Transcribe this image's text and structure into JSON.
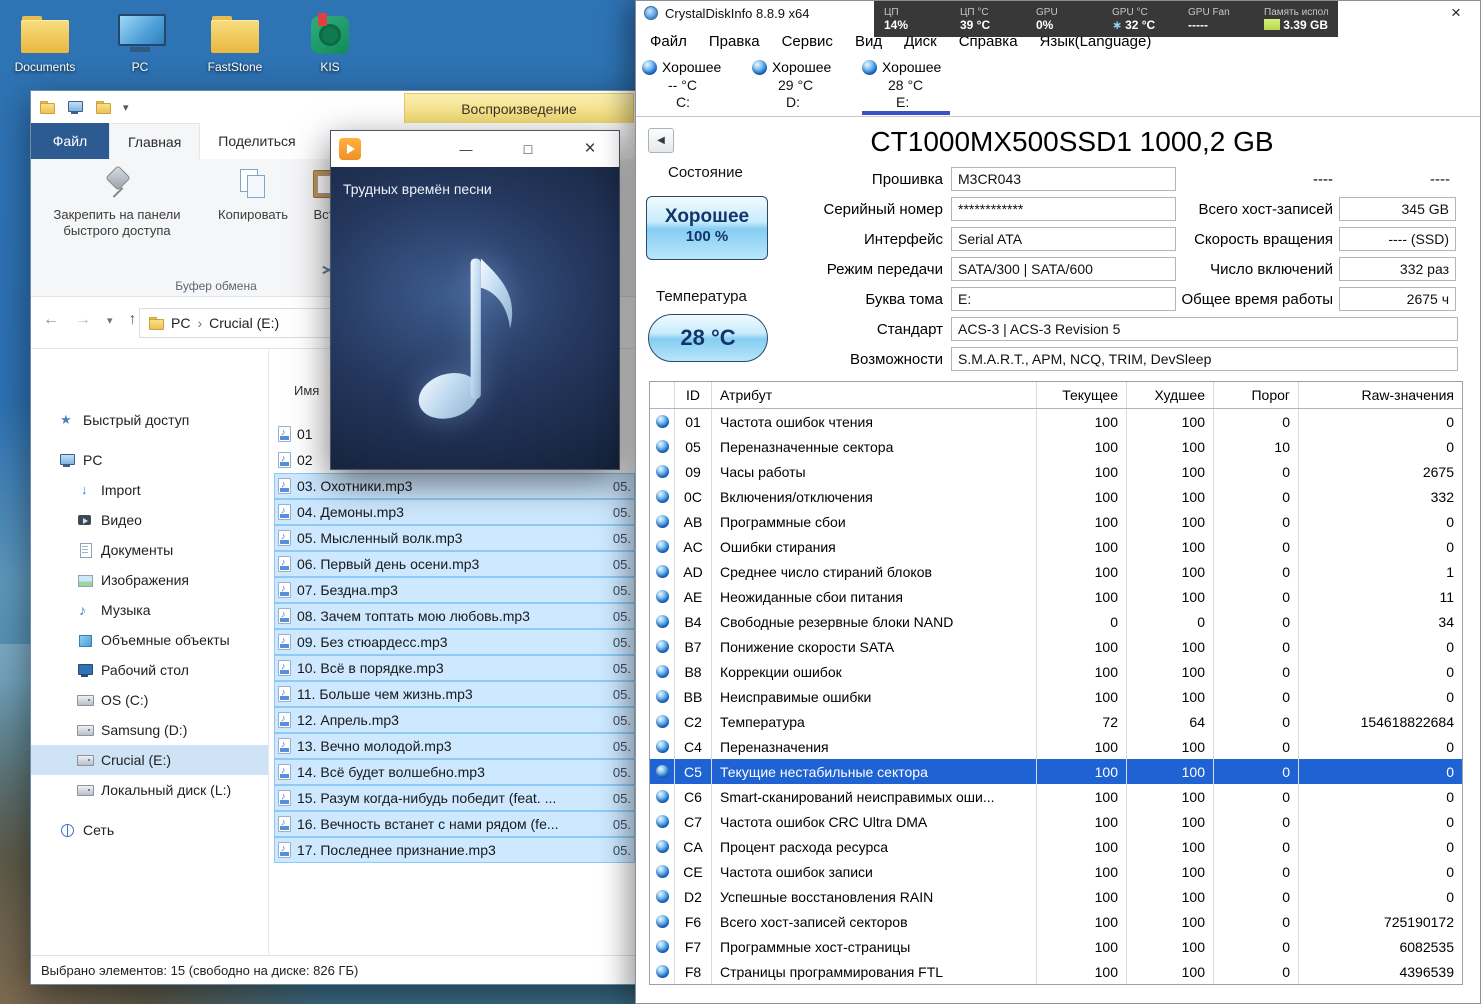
{
  "desktop": {
    "icons": [
      {
        "label": "Documents",
        "icon": "desk-folder"
      },
      {
        "label": "PC",
        "icon": "desk-computer"
      },
      {
        "label": "FastStone",
        "icon": "desk-folder"
      },
      {
        "label": "KIS",
        "icon": "desk-kis"
      }
    ]
  },
  "explorer": {
    "context_tab": "Воспроизведение",
    "file_tab": "Файл",
    "tabs": [
      {
        "label": "Главная",
        "selected": true
      },
      {
        "label": "Поделиться",
        "selected": false
      }
    ],
    "ribbon": {
      "pin": "Закрепить на панели быстрого доступа",
      "copy": "Копировать",
      "paste": "Вст",
      "group": "Буфер обмена"
    },
    "address": {
      "crumb_root": "PC",
      "crumb_current": "Crucial (E:)"
    },
    "sidebar": [
      {
        "label": "Быстрый доступ",
        "icon": "star"
      },
      {
        "label": "PC",
        "icon": "computer",
        "gap": true
      },
      {
        "label": "Import",
        "icon": "download",
        "child": true
      },
      {
        "label": "Видео",
        "icon": "video",
        "child": true
      },
      {
        "label": "Документы",
        "icon": "document",
        "child": true
      },
      {
        "label": "Изображения",
        "icon": "picture",
        "child": true
      },
      {
        "label": "Музыка",
        "icon": "music",
        "child": true
      },
      {
        "label": "Объемные объекты",
        "icon": "box3d",
        "child": true
      },
      {
        "label": "Рабочий стол",
        "icon": "desktop",
        "child": true
      },
      {
        "label": "OS (C:)",
        "icon": "drive",
        "child": true
      },
      {
        "label": "Samsung (D:)",
        "icon": "drive",
        "child": true
      },
      {
        "label": "Crucial (E:)",
        "icon": "drive",
        "child": true,
        "selected": true
      },
      {
        "label": "Локальный диск (L:)",
        "icon": "drive",
        "child": true
      },
      {
        "label": "Сеть",
        "icon": "network",
        "gap": true
      }
    ],
    "list_header": "Имя",
    "files": [
      {
        "name": "01",
        "selected": false,
        "right": ""
      },
      {
        "name": "02",
        "selected": false,
        "right": ""
      },
      {
        "name": "03. Охотники.mp3",
        "selected": true,
        "right": "05."
      },
      {
        "name": "04. Демоны.mp3",
        "selected": true,
        "right": "05."
      },
      {
        "name": "05. Мысленный волк.mp3",
        "selected": true,
        "right": "05."
      },
      {
        "name": "06. Первый день осени.mp3",
        "selected": true,
        "right": "05."
      },
      {
        "name": "07. Бездна.mp3",
        "selected": true,
        "right": "05."
      },
      {
        "name": "08. Зачем топтать мою любовь.mp3",
        "selected": true,
        "right": "05."
      },
      {
        "name": "09. Без стюардесс.mp3",
        "selected": true,
        "right": "05."
      },
      {
        "name": "10. Всё в порядке.mp3",
        "selected": true,
        "right": "05."
      },
      {
        "name": "11. Больше чем жизнь.mp3",
        "selected": true,
        "right": "05."
      },
      {
        "name": "12. Апрель.mp3",
        "selected": true,
        "right": "05."
      },
      {
        "name": "13. Вечно молодой.mp3",
        "selected": true,
        "right": "05."
      },
      {
        "name": "14. Всё будет волшебно.mp3",
        "selected": true,
        "right": "05."
      },
      {
        "name": "15. Разум когда-нибудь победит (feat. ...",
        "selected": true,
        "right": "05."
      },
      {
        "name": "16. Вечность встанет с нами рядом (fe...",
        "selected": true,
        "right": "05."
      },
      {
        "name": "17. Последнее признание.mp3",
        "selected": true,
        "right": "05."
      }
    ],
    "status": "Выбрано элементов: 15 (свободно на диске: 826 ГБ)"
  },
  "player": {
    "song_title": "Трудных времён песни"
  },
  "cdi": {
    "window_title": "CrystalDiskInfo 8.8.9 x64",
    "monitor": [
      {
        "label": "ЦП",
        "value": "14%"
      },
      {
        "label": "ЦП °C",
        "value": "39 °C"
      },
      {
        "label": "GPU",
        "value": "0%"
      },
      {
        "label": "GPU °C",
        "value": "32 °C",
        "cold": true
      },
      {
        "label": "GPU Fan",
        "value": "-----"
      },
      {
        "label": "Память использ...",
        "value": "3.39 GB",
        "bar": true
      }
    ],
    "menu": [
      "Файл",
      "Правка",
      "Сервис",
      "Вид",
      "Диск",
      "Справка",
      "Язык(Language)"
    ],
    "drives": [
      {
        "status": "Хорошее",
        "temp": "-- °C",
        "letter": "C:"
      },
      {
        "status": "Хорошее",
        "temp": "29 °C",
        "letter": "D:"
      },
      {
        "status": "Хорошее",
        "temp": "28 °C",
        "letter": "E:",
        "selected": true
      }
    ],
    "model": "CT1000MX500SSD1 1000,2 GB",
    "health": {
      "label": "Состояние",
      "status": "Хорошее",
      "percent": "100 %"
    },
    "temperature": {
      "label": "Температура",
      "value": "28 °C"
    },
    "info_left": [
      {
        "label": "Прошивка",
        "value": "M3CR043"
      },
      {
        "label": "Серийный номер",
        "value": "************"
      },
      {
        "label": "Интерфейс",
        "value": "Serial ATA"
      },
      {
        "label": "Режим передачи",
        "value": "SATA/300 | SATA/600"
      },
      {
        "label": "Буква тома",
        "value": "E:"
      },
      {
        "label": "Стандарт",
        "value": "ACS-3 | ACS-3 Revision 5",
        "wide": true
      },
      {
        "label": "Возможности",
        "value": "S.M.A.R.T., APM, NCQ, TRIM, DevSleep",
        "wide": true
      }
    ],
    "info_right": [
      {
        "label": "----",
        "value": "----",
        "nobox": true
      },
      {
        "label": "Всего хост-записей",
        "value": "345 GB"
      },
      {
        "label": "Скорость вращения",
        "value": "---- (SSD)"
      },
      {
        "label": "Число включений",
        "value": "332 раз"
      },
      {
        "label": "Общее время работы",
        "value": "2675 ч"
      }
    ],
    "smart_headers": {
      "id": "ID",
      "attr": "Атрибут",
      "cur": "Текущее",
      "worst": "Худшее",
      "thr": "Порог",
      "raw": "Raw-значения"
    },
    "smart_rows": [
      {
        "id": "01",
        "attr": "Частота ошибок чтения",
        "cur": "100",
        "worst": "100",
        "thr": "0",
        "raw": "0"
      },
      {
        "id": "05",
        "attr": "Переназначенные сектора",
        "cur": "100",
        "worst": "100",
        "thr": "10",
        "raw": "0"
      },
      {
        "id": "09",
        "attr": "Часы работы",
        "cur": "100",
        "worst": "100",
        "thr": "0",
        "raw": "2675"
      },
      {
        "id": "0C",
        "attr": "Включения/отключения",
        "cur": "100",
        "worst": "100",
        "thr": "0",
        "raw": "332"
      },
      {
        "id": "AB",
        "attr": "Программные сбои",
        "cur": "100",
        "worst": "100",
        "thr": "0",
        "raw": "0"
      },
      {
        "id": "AC",
        "attr": "Ошибки стирания",
        "cur": "100",
        "worst": "100",
        "thr": "0",
        "raw": "0"
      },
      {
        "id": "AD",
        "attr": "Среднее число стираний блоков",
        "cur": "100",
        "worst": "100",
        "thr": "0",
        "raw": "1"
      },
      {
        "id": "AE",
        "attr": "Неожиданные сбои питания",
        "cur": "100",
        "worst": "100",
        "thr": "0",
        "raw": "11"
      },
      {
        "id": "B4",
        "attr": "Свободные резервные блоки NAND",
        "cur": "0",
        "worst": "0",
        "thr": "0",
        "raw": "34"
      },
      {
        "id": "B7",
        "attr": "Понижение скорости SATA",
        "cur": "100",
        "worst": "100",
        "thr": "0",
        "raw": "0"
      },
      {
        "id": "B8",
        "attr": "Коррекции ошибок",
        "cur": "100",
        "worst": "100",
        "thr": "0",
        "raw": "0"
      },
      {
        "id": "BB",
        "attr": "Неисправимые ошибки",
        "cur": "100",
        "worst": "100",
        "thr": "0",
        "raw": "0"
      },
      {
        "id": "C2",
        "attr": "Температура",
        "cur": "72",
        "worst": "64",
        "thr": "0",
        "raw": "154618822684"
      },
      {
        "id": "C4",
        "attr": "Переназначения",
        "cur": "100",
        "worst": "100",
        "thr": "0",
        "raw": "0"
      },
      {
        "id": "C5",
        "attr": "Текущие нестабильные сектора",
        "cur": "100",
        "worst": "100",
        "thr": "0",
        "raw": "0",
        "selected": true
      },
      {
        "id": "C6",
        "attr": "Smart-сканирований неисправимых оши...",
        "cur": "100",
        "worst": "100",
        "thr": "0",
        "raw": "0"
      },
      {
        "id": "C7",
        "attr": "Частота ошибок CRC Ultra DMA",
        "cur": "100",
        "worst": "100",
        "thr": "0",
        "raw": "0"
      },
      {
        "id": "CA",
        "attr": "Процент расхода ресурса",
        "cur": "100",
        "worst": "100",
        "thr": "0",
        "raw": "0"
      },
      {
        "id": "CE",
        "attr": "Частота ошибок записи",
        "cur": "100",
        "worst": "100",
        "thr": "0",
        "raw": "0"
      },
      {
        "id": "D2",
        "attr": "Успешные восстановления RAIN",
        "cur": "100",
        "worst": "100",
        "thr": "0",
        "raw": "0"
      },
      {
        "id": "F6",
        "attr": "Всего хост-записей секторов",
        "cur": "100",
        "worst": "100",
        "thr": "0",
        "raw": "725190172"
      },
      {
        "id": "F7",
        "attr": "Программные хост-страницы",
        "cur": "100",
        "worst": "100",
        "thr": "0",
        "raw": "6082535"
      },
      {
        "id": "F8",
        "attr": "Страницы программирования FTL",
        "cur": "100",
        "worst": "100",
        "thr": "0",
        "raw": "4396539"
      }
    ]
  }
}
